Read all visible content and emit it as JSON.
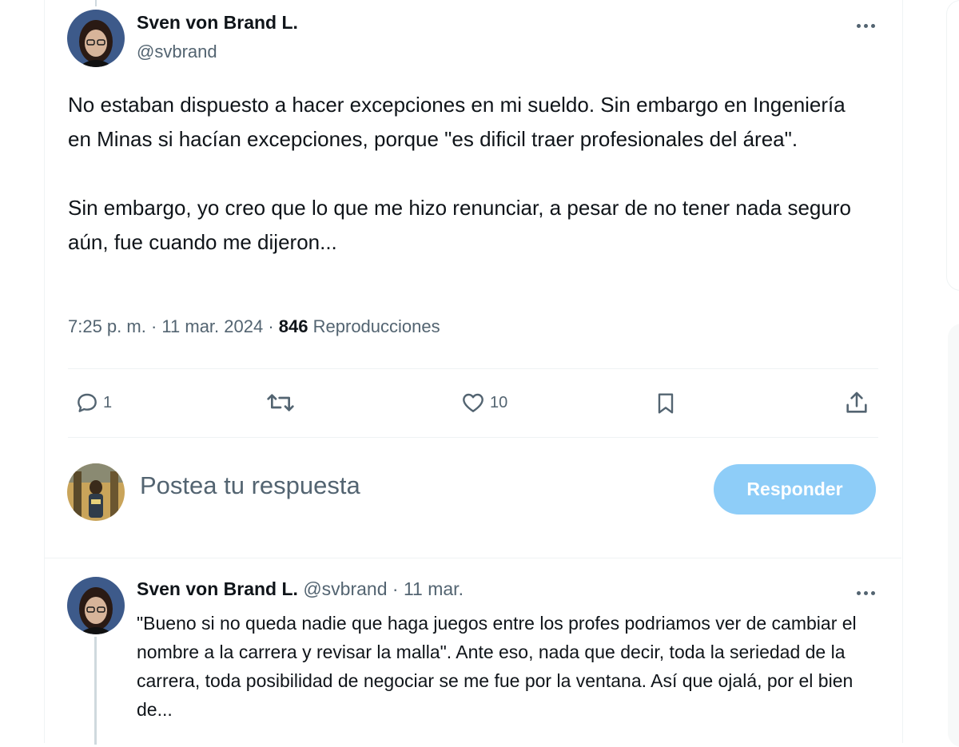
{
  "tweet": {
    "author_name": "Sven von Brand L.",
    "author_handle": "@svbrand",
    "paragraphs": [
      "No estaban dispuesto a hacer excepciones en mi sueldo. Sin embargo en Ingeniería en Minas si hacían excepciones, porque \"es dificil traer profesionales del área\".",
      "Sin embargo, yo creo que lo que me hizo renunciar, a pesar de no tener nada seguro aún, fue cuando me dijeron..."
    ],
    "time": "7:25 p. m.",
    "sep": "·",
    "date": "11 mar. 2024",
    "views_count": "846",
    "views_label": "Reproducciones",
    "actions": {
      "reply_count": "1",
      "retweet_count": "",
      "like_count": "10"
    },
    "icons": [
      "reply-icon",
      "retweet-icon",
      "like-icon",
      "bookmark-icon",
      "share-icon",
      "more-icon"
    ]
  },
  "composer": {
    "placeholder": "Postea tu respuesta",
    "button_label": "Responder",
    "button_color": "#8ecdf8"
  },
  "reply": {
    "author_name": "Sven von Brand L.",
    "author_handle": "@svbrand",
    "sep": "·",
    "date": "11 mar.",
    "text": "\"Bueno si no queda nadie que haga juegos entre los profes podriamos ver de cambiar el nombre a la carrera y revisar la malla\". Ante eso, nada que decir, toda la seriedad de la carrera, toda posibilidad de negociar se me fue por la ventana. Así que ojalá, por el bien de..."
  },
  "colors": {
    "text_primary": "#0f1419",
    "text_secondary": "#536471",
    "divider": "#eff3f4"
  }
}
